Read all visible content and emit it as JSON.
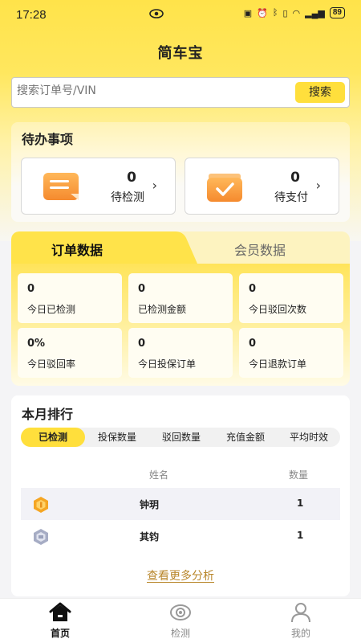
{
  "status_bar": {
    "time": "17:28",
    "battery": "89"
  },
  "app": {
    "title": "简车宝"
  },
  "search": {
    "placeholder": "搜索订单号/VIN",
    "button": "搜索"
  },
  "todo": {
    "title": "待办事项",
    "items": [
      {
        "count": "0",
        "label": "待检测",
        "icon": "clipboard-note-icon"
      },
      {
        "count": "0",
        "label": "待支付",
        "icon": "payment-check-icon"
      }
    ]
  },
  "data_tabs": {
    "active": "订单数据",
    "inactive": "会员数据",
    "stats": [
      {
        "value": "0",
        "label": "今日已检测"
      },
      {
        "value": "0",
        "label": "已检测金额"
      },
      {
        "value": "0",
        "label": "今日驳回次数"
      },
      {
        "value": "0%",
        "label": "今日驳回率"
      },
      {
        "value": "0",
        "label": "今日投保订单"
      },
      {
        "value": "0",
        "label": "今日退款订单"
      }
    ]
  },
  "ranking": {
    "title": "本月排行",
    "tabs": [
      "已检测",
      "投保数量",
      "驳回数量",
      "充值金额",
      "平均时效"
    ],
    "active_tab": "已检测",
    "columns": [
      "姓名",
      "数量"
    ],
    "rows": [
      {
        "name": "钟玥",
        "qty": "1",
        "medal": "gold-medal-icon"
      },
      {
        "name": "其钧",
        "qty": "1",
        "medal": "silver-medal-icon"
      }
    ],
    "more": "查看更多分析"
  },
  "nav": [
    {
      "label": "首页",
      "icon": "home-icon",
      "active": true
    },
    {
      "label": "检测",
      "icon": "eye-icon",
      "active": false
    },
    {
      "label": "我的",
      "icon": "user-icon",
      "active": false
    }
  ],
  "colors": {
    "accent": "#ffdf3c",
    "link": "#b8862a",
    "orange": "#f7a03c"
  }
}
